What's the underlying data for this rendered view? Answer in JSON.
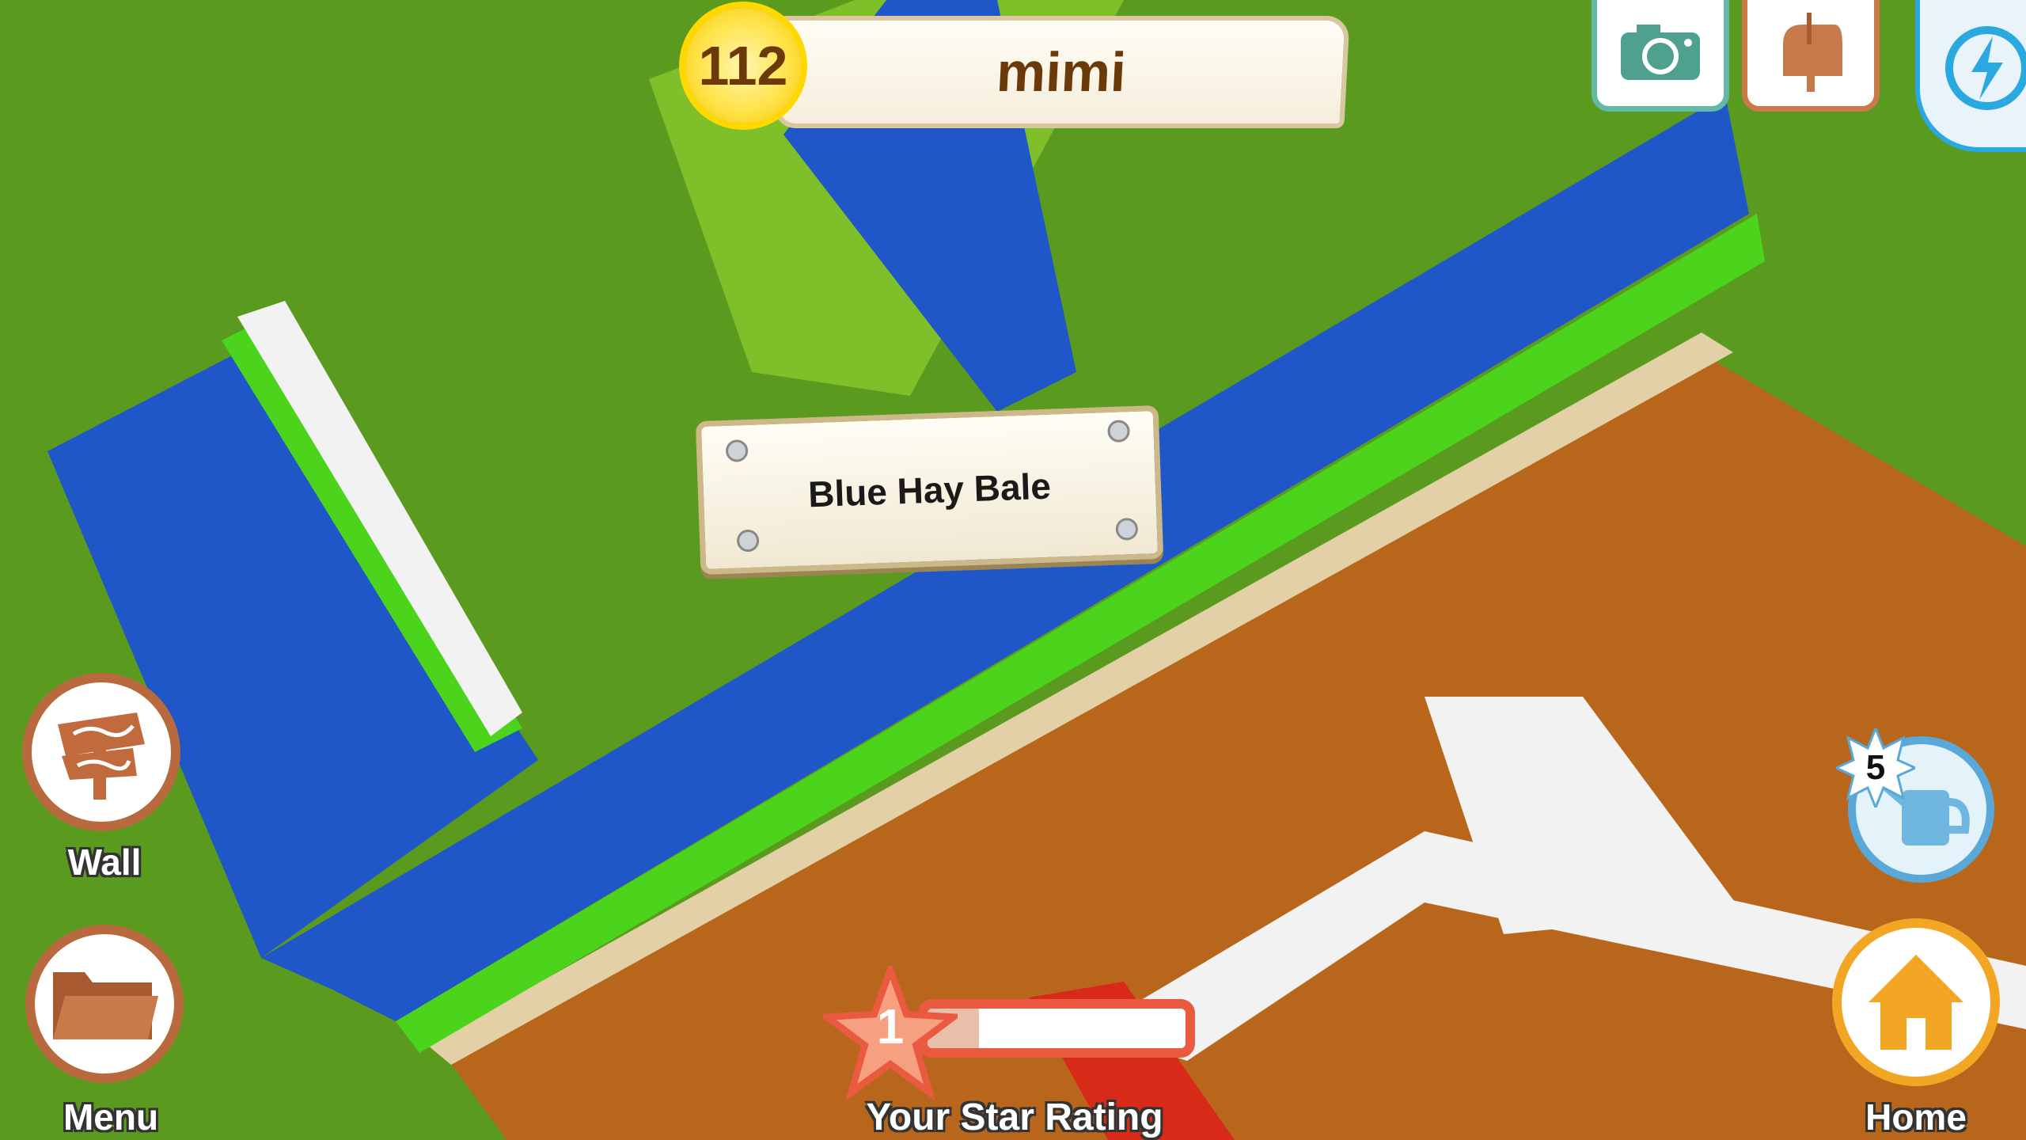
{
  "player": {
    "level": "112",
    "name": "mimi"
  },
  "tooltip": {
    "item_name": "Blue Hay Bale"
  },
  "top_buttons": [
    {
      "name": "camera",
      "icon": "camera-icon",
      "color": "#64b8a6"
    },
    {
      "name": "mailbox",
      "icon": "mailbox-icon",
      "color": "#c87a4a"
    },
    {
      "name": "energy",
      "icon": "lightning-icon",
      "color": "#2aa8e0"
    }
  ],
  "left_buttons": {
    "wall_label": "Wall",
    "menu_label": "Menu"
  },
  "star_rating": {
    "level": "1",
    "label": "Your Star Rating",
    "progress": 0.2,
    "color": "#ea5a40"
  },
  "watering_can": {
    "count": "5",
    "icon": "watering-can-icon"
  },
  "home": {
    "label": "Home",
    "icon": "house-icon",
    "color": "#f3a623"
  },
  "colors": {
    "grass": "#5a9a1e",
    "soil": "#b8661c",
    "blue_hay": "#1f56c8",
    "green_hedge": "#4cd41c",
    "white_hay": "#f2f2f2",
    "red_hay": "#d82a18"
  }
}
